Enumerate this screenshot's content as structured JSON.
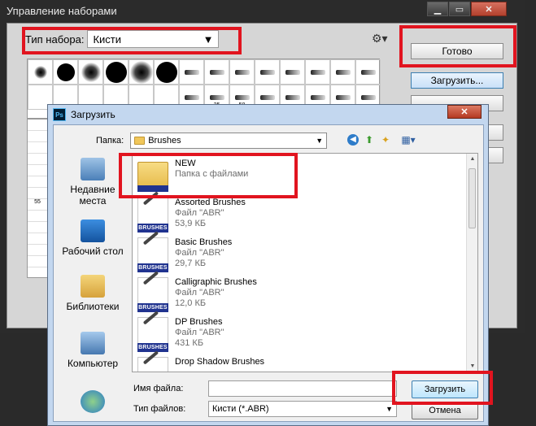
{
  "outer": {
    "title": "Управление наборами",
    "preset_type_label": "Тип набора:",
    "preset_type_value": "Кисти",
    "done_button": "Готово",
    "load_button": "Загрузить...",
    "grid_row2_labels": [
      "",
      "",
      "",
      "",
      "",
      "",
      "",
      "25",
      "50",
      "",
      "",
      "",
      "",
      ""
    ],
    "left_labels": [
      "",
      "",
      "",
      "",
      "",
      "",
      "",
      "55",
      "",
      "",
      "",
      "",
      ""
    ]
  },
  "dialog": {
    "title": "Загрузить",
    "folder_label": "Папка:",
    "folder_value": "Brushes",
    "places": [
      {
        "label": "Недавние места"
      },
      {
        "label": "Рабочий стол"
      },
      {
        "label": "Библиотеки"
      },
      {
        "label": "Компьютер"
      }
    ],
    "files": [
      {
        "name": "NEW",
        "type": "Папка с файлами",
        "size": "",
        "badge": ""
      },
      {
        "name": "Assorted Brushes",
        "type": "Файл \"ABR\"",
        "size": "53,9 КБ",
        "badge": "BRUSHES"
      },
      {
        "name": "Basic Brushes",
        "type": "Файл \"ABR\"",
        "size": "29,7 КБ",
        "badge": "BRUSHES"
      },
      {
        "name": "Calligraphic Brushes",
        "type": "Файл \"ABR\"",
        "size": "12,0 КБ",
        "badge": "BRUSHES"
      },
      {
        "name": "DP Brushes",
        "type": "Файл \"ABR\"",
        "size": "431 КБ",
        "badge": "BRUSHES"
      },
      {
        "name": "Drop Shadow Brushes",
        "type": "",
        "size": "",
        "badge": ""
      }
    ],
    "filename_label": "Имя файла:",
    "filename_value": "",
    "filetype_label": "Тип файлов:",
    "filetype_value": "Кисти (*.ABR)",
    "load_button": "Загрузить",
    "cancel_button": "Отмена"
  },
  "colors": {
    "highlight": "#e1141f",
    "badge": "#20338f"
  }
}
